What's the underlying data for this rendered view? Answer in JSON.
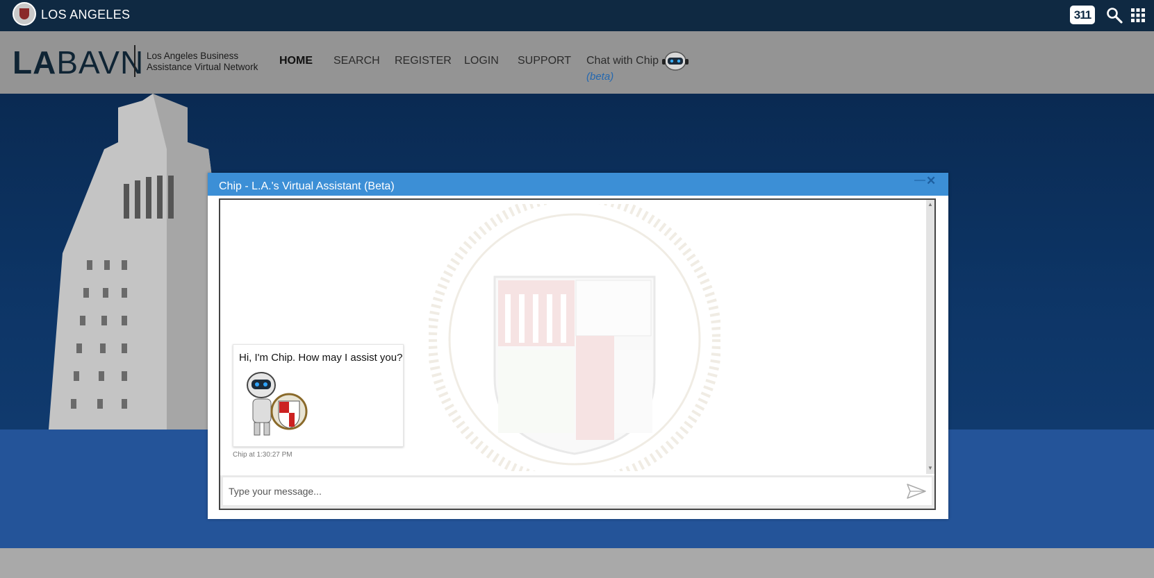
{
  "topbar": {
    "city_name": "LOS ANGELES",
    "badge_311": "311"
  },
  "brand": {
    "logo_la": "LA",
    "logo_bavn": "BAVN",
    "subtitle_line1": "Los Angeles Business",
    "subtitle_line2": "Assistance Virtual Network"
  },
  "nav": {
    "items": [
      {
        "label": "HOME",
        "active": true
      },
      {
        "label": "SEARCH"
      },
      {
        "label": "REGISTER"
      },
      {
        "label": "LOGIN"
      },
      {
        "label": "SUPPORT"
      }
    ],
    "chat_label": "Chat with Chip",
    "chat_beta": "(beta)"
  },
  "chat": {
    "title": "Chip - L.A.'s Virtual Assistant (Beta)",
    "minimize": "—",
    "close": "✕",
    "messages": [
      {
        "text": "Hi, I'm Chip. How may I assist you?",
        "meta": "Chip at 1:30:27 PM"
      }
    ],
    "input_placeholder": "Type your message..."
  },
  "colors": {
    "topbar": "#0f2942",
    "chat_header": "#3c8fd6",
    "hero_blue": "#245499"
  }
}
